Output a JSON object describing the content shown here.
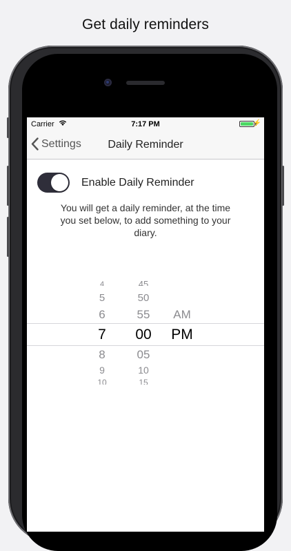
{
  "headline": "Get daily reminders",
  "status": {
    "carrier": "Carrier",
    "time": "7:17 PM"
  },
  "nav": {
    "back_label": "Settings",
    "title": "Daily Reminder"
  },
  "reminder": {
    "toggle_on": true,
    "label": "Enable Daily Reminder",
    "description": "You will get a daily reminder, at the time you set below, to add something to your diary."
  },
  "picker": {
    "hours": [
      "4",
      "5",
      "6",
      "7",
      "8",
      "9",
      "10"
    ],
    "minutes": [
      "45",
      "50",
      "55",
      "00",
      "05",
      "10",
      "15"
    ],
    "ampm": [
      "AM",
      "PM"
    ],
    "selected": {
      "hour": "7",
      "minute": "00",
      "ampm": "PM"
    }
  },
  "colors": {
    "toggle_on": "#2f2e3a",
    "battery": "#4cd964"
  }
}
